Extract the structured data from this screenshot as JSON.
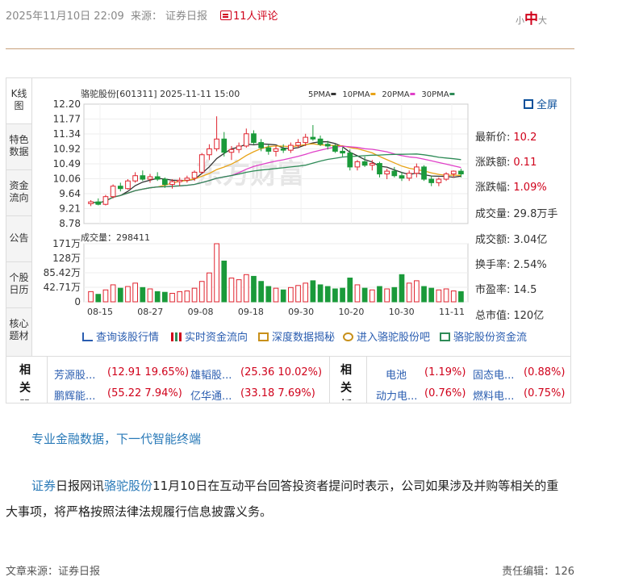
{
  "meta": {
    "datetime": "2025年11月10日 22:09",
    "source_label": "来源：",
    "source": "证券日报",
    "comments": "11人评论",
    "font_small": "小",
    "font_mid": "中",
    "font_large": "大"
  },
  "tabs": [
    {
      "label": "K线图"
    },
    {
      "label": "特色数据"
    },
    {
      "label": "资金流向"
    },
    {
      "label": "公告"
    },
    {
      "label": "个股日历"
    },
    {
      "label": "核心题材"
    }
  ],
  "chart": {
    "header": "骆驼股份[601311] 2025-11-11 15:00",
    "legend": [
      "5PMA",
      "10PMA",
      "20PMA",
      "30PMA"
    ],
    "volume_label": "成交量：298411",
    "watermark": "东方财富",
    "fullscreen": "全屏"
  },
  "chart_data": {
    "type": "candlestick",
    "title": "骆驼股份[601311] 2025-11-11 15:00",
    "price_ticks": [
      "12.20",
      "11.77",
      "11.34",
      "10.92",
      "10.49",
      "10.06",
      "9.64",
      "9.21",
      "8.78"
    ],
    "ylim": [
      8.78,
      12.2
    ],
    "volume_ticks": [
      "171万",
      "128万",
      "85.42万",
      "42.71万",
      "0"
    ],
    "volume_ylim": [
      0,
      171
    ],
    "x_ticks": [
      "08-15",
      "08-27",
      "09-08",
      "09-18",
      "09-30",
      "10-20",
      "10-30",
      "11-11"
    ],
    "series": [
      {
        "name": "5PMA",
        "color": "#333333"
      },
      {
        "name": "10PMA",
        "color": "#e8a317"
      },
      {
        "name": "20PMA",
        "color": "#e040c8"
      },
      {
        "name": "30PMA",
        "color": "#2e8b57"
      }
    ],
    "candles": [
      [
        9.35,
        9.45,
        9.28,
        9.4,
        30
      ],
      [
        9.4,
        9.5,
        9.3,
        9.33,
        22
      ],
      [
        9.33,
        9.6,
        9.3,
        9.55,
        35
      ],
      [
        9.55,
        9.9,
        9.5,
        9.85,
        50
      ],
      [
        9.85,
        9.95,
        9.7,
        9.78,
        40
      ],
      [
        9.78,
        10.05,
        9.75,
        10.0,
        45
      ],
      [
        10.0,
        10.25,
        9.95,
        10.15,
        55
      ],
      [
        10.15,
        10.3,
        10.0,
        10.05,
        42
      ],
      [
        10.05,
        10.2,
        9.95,
        10.12,
        38
      ],
      [
        10.12,
        10.25,
        10.0,
        10.05,
        30
      ],
      [
        10.05,
        10.1,
        9.8,
        9.9,
        28
      ],
      [
        9.9,
        10.05,
        9.78,
        9.98,
        25
      ],
      [
        9.98,
        10.1,
        9.85,
        10.02,
        30
      ],
      [
        10.02,
        10.15,
        9.95,
        10.08,
        32
      ],
      [
        10.08,
        10.3,
        10.0,
        10.25,
        40
      ],
      [
        10.25,
        10.8,
        10.2,
        10.75,
        60
      ],
      [
        10.75,
        11.05,
        10.6,
        10.92,
        85
      ],
      [
        10.92,
        11.85,
        10.85,
        11.2,
        171
      ],
      [
        11.2,
        11.4,
        10.7,
        10.82,
        120
      ],
      [
        10.82,
        11.0,
        10.6,
        10.9,
        70
      ],
      [
        10.9,
        11.1,
        10.8,
        11.0,
        65
      ],
      [
        11.0,
        11.5,
        10.95,
        11.35,
        80
      ],
      [
        11.35,
        11.45,
        11.05,
        11.1,
        75
      ],
      [
        11.1,
        11.2,
        10.85,
        10.95,
        60
      ],
      [
        10.95,
        11.05,
        10.75,
        10.85,
        45
      ],
      [
        10.85,
        11.0,
        10.7,
        10.92,
        40
      ],
      [
        10.92,
        11.05,
        10.8,
        10.88,
        35
      ],
      [
        10.88,
        11.1,
        10.8,
        11.02,
        42
      ],
      [
        11.02,
        11.2,
        10.95,
        11.1,
        48
      ],
      [
        11.1,
        11.35,
        11.0,
        11.25,
        55
      ],
      [
        11.25,
        11.6,
        11.15,
        11.2,
        62
      ],
      [
        11.2,
        11.3,
        11.0,
        11.05,
        50
      ],
      [
        11.05,
        11.15,
        10.9,
        11.0,
        45
      ],
      [
        11.0,
        11.05,
        10.8,
        10.85,
        38
      ],
      [
        10.85,
        10.95,
        10.7,
        10.8,
        40
      ],
      [
        10.8,
        10.9,
        10.3,
        10.4,
        70
      ],
      [
        10.4,
        10.6,
        10.3,
        10.55,
        50
      ],
      [
        10.55,
        10.7,
        10.4,
        10.45,
        40
      ],
      [
        10.45,
        10.6,
        10.3,
        10.5,
        35
      ],
      [
        10.5,
        10.55,
        10.1,
        10.2,
        45
      ],
      [
        10.2,
        10.35,
        10.05,
        10.28,
        38
      ],
      [
        10.28,
        10.4,
        10.1,
        10.15,
        42
      ],
      [
        10.15,
        10.25,
        10.0,
        10.08,
        80
      ],
      [
        10.08,
        10.3,
        10.0,
        10.22,
        55
      ],
      [
        10.22,
        10.5,
        10.1,
        10.4,
        62
      ],
      [
        10.4,
        10.45,
        10.0,
        10.05,
        45
      ],
      [
        10.05,
        10.15,
        9.85,
        9.95,
        40
      ],
      [
        9.95,
        10.1,
        9.85,
        10.05,
        35
      ],
      [
        10.05,
        10.25,
        10.0,
        10.2,
        38
      ],
      [
        10.2,
        10.3,
        10.1,
        10.28,
        32
      ],
      [
        10.28,
        10.35,
        10.1,
        10.2,
        30
      ]
    ]
  },
  "stats": [
    {
      "label": "最新价:",
      "value": "10.2",
      "up": true
    },
    {
      "label": "涨跌额:",
      "value": "0.11",
      "up": true
    },
    {
      "label": "涨跌幅:",
      "value": "1.09%",
      "up": true
    },
    {
      "label": "成交量:",
      "value": "29.8万手",
      "up": false
    },
    {
      "label": "成交额:",
      "value": "3.04亿",
      "up": false
    },
    {
      "label": "换手率:",
      "value": "2.54%",
      "up": false
    },
    {
      "label": "市盈率:",
      "value": "14.5",
      "up": false
    },
    {
      "label": "总市值:",
      "value": "120亿",
      "up": false
    }
  ],
  "links": [
    {
      "label": "查询该股行情"
    },
    {
      "label": "实时资金流向"
    },
    {
      "label": "深度数据揭秘"
    },
    {
      "label": "进入骆驼股份吧"
    },
    {
      "label": "骆驼股份资金流"
    }
  ],
  "related_stocks": {
    "header": "相关股",
    "items": [
      {
        "name": "芳源股...",
        "value": "(12.91 19.65%)"
      },
      {
        "name": "雄韬股...",
        "value": "(25.36 10.02%)"
      },
      {
        "name": "鹏辉能...",
        "value": "(55.22 7.94%)"
      },
      {
        "name": "亿华通...",
        "value": "(33.18 7.69%)"
      }
    ]
  },
  "related_sectors": {
    "header": "相关板",
    "items": [
      {
        "name": "电池",
        "value": "(1.19%)"
      },
      {
        "name": "固态电...",
        "value": "(0.88%)"
      },
      {
        "name": "动力电...",
        "value": "(0.76%)"
      },
      {
        "name": "燃料电...",
        "value": "(0.75%)"
      }
    ]
  },
  "slogan": "专业金融数据，下一代智能终端",
  "article": {
    "link1": "证券",
    "text1": "日报网讯",
    "link2": "骆驼股份",
    "text2": "11月10日在互动平台回答投资者提问时表示，公司如果涉及并购等相关的重大事项，将严格按照法律法规履行信息披露义务。"
  },
  "footer": {
    "source": "文章来源：证券日报",
    "editor": "责任编辑：126"
  }
}
